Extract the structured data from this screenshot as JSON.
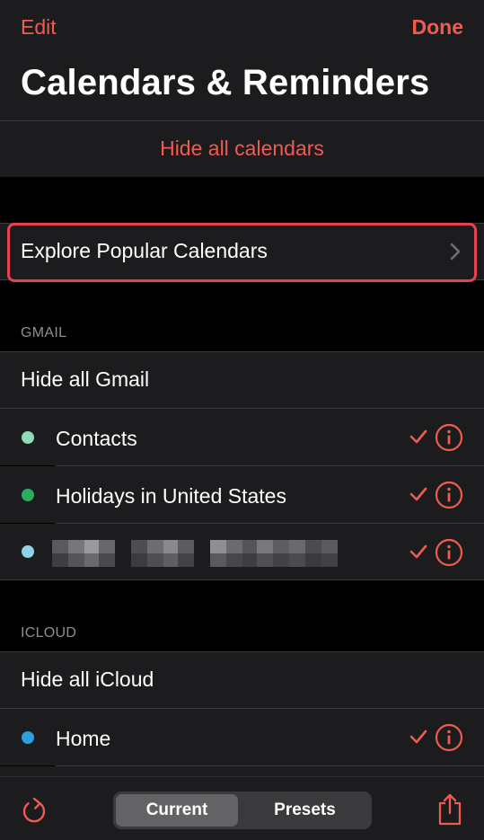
{
  "nav": {
    "edit_label": "Edit",
    "done_label": "Done"
  },
  "title": "Calendars & Reminders",
  "hide_all_calendars": "Hide all calendars",
  "explore": {
    "label": "Explore Popular Calendars"
  },
  "sections": [
    {
      "header": "GMAIL",
      "hide_all": "Hide all Gmail",
      "calendars": [
        {
          "name": "Contacts",
          "color": "#8edbb6",
          "checked": true
        },
        {
          "name": "Holidays in United States",
          "color": "#27ae60",
          "checked": true
        },
        {
          "name": "",
          "color": "#8fd3e8",
          "checked": true
        }
      ]
    },
    {
      "header": "ICLOUD",
      "hide_all": "Hide all iCloud",
      "calendars": [
        {
          "name": "Home",
          "color": "#2d9fdb",
          "checked": true
        }
      ]
    }
  ],
  "toolbar": {
    "segments": [
      "Current",
      "Presets"
    ],
    "selected": "Current",
    "icons": [
      "refresh-icon",
      "share-icon"
    ]
  },
  "colors": {
    "accent": "#ef5b50",
    "highlight": "#e8414f",
    "background": "#000000",
    "cell": "#1c1c1e"
  }
}
